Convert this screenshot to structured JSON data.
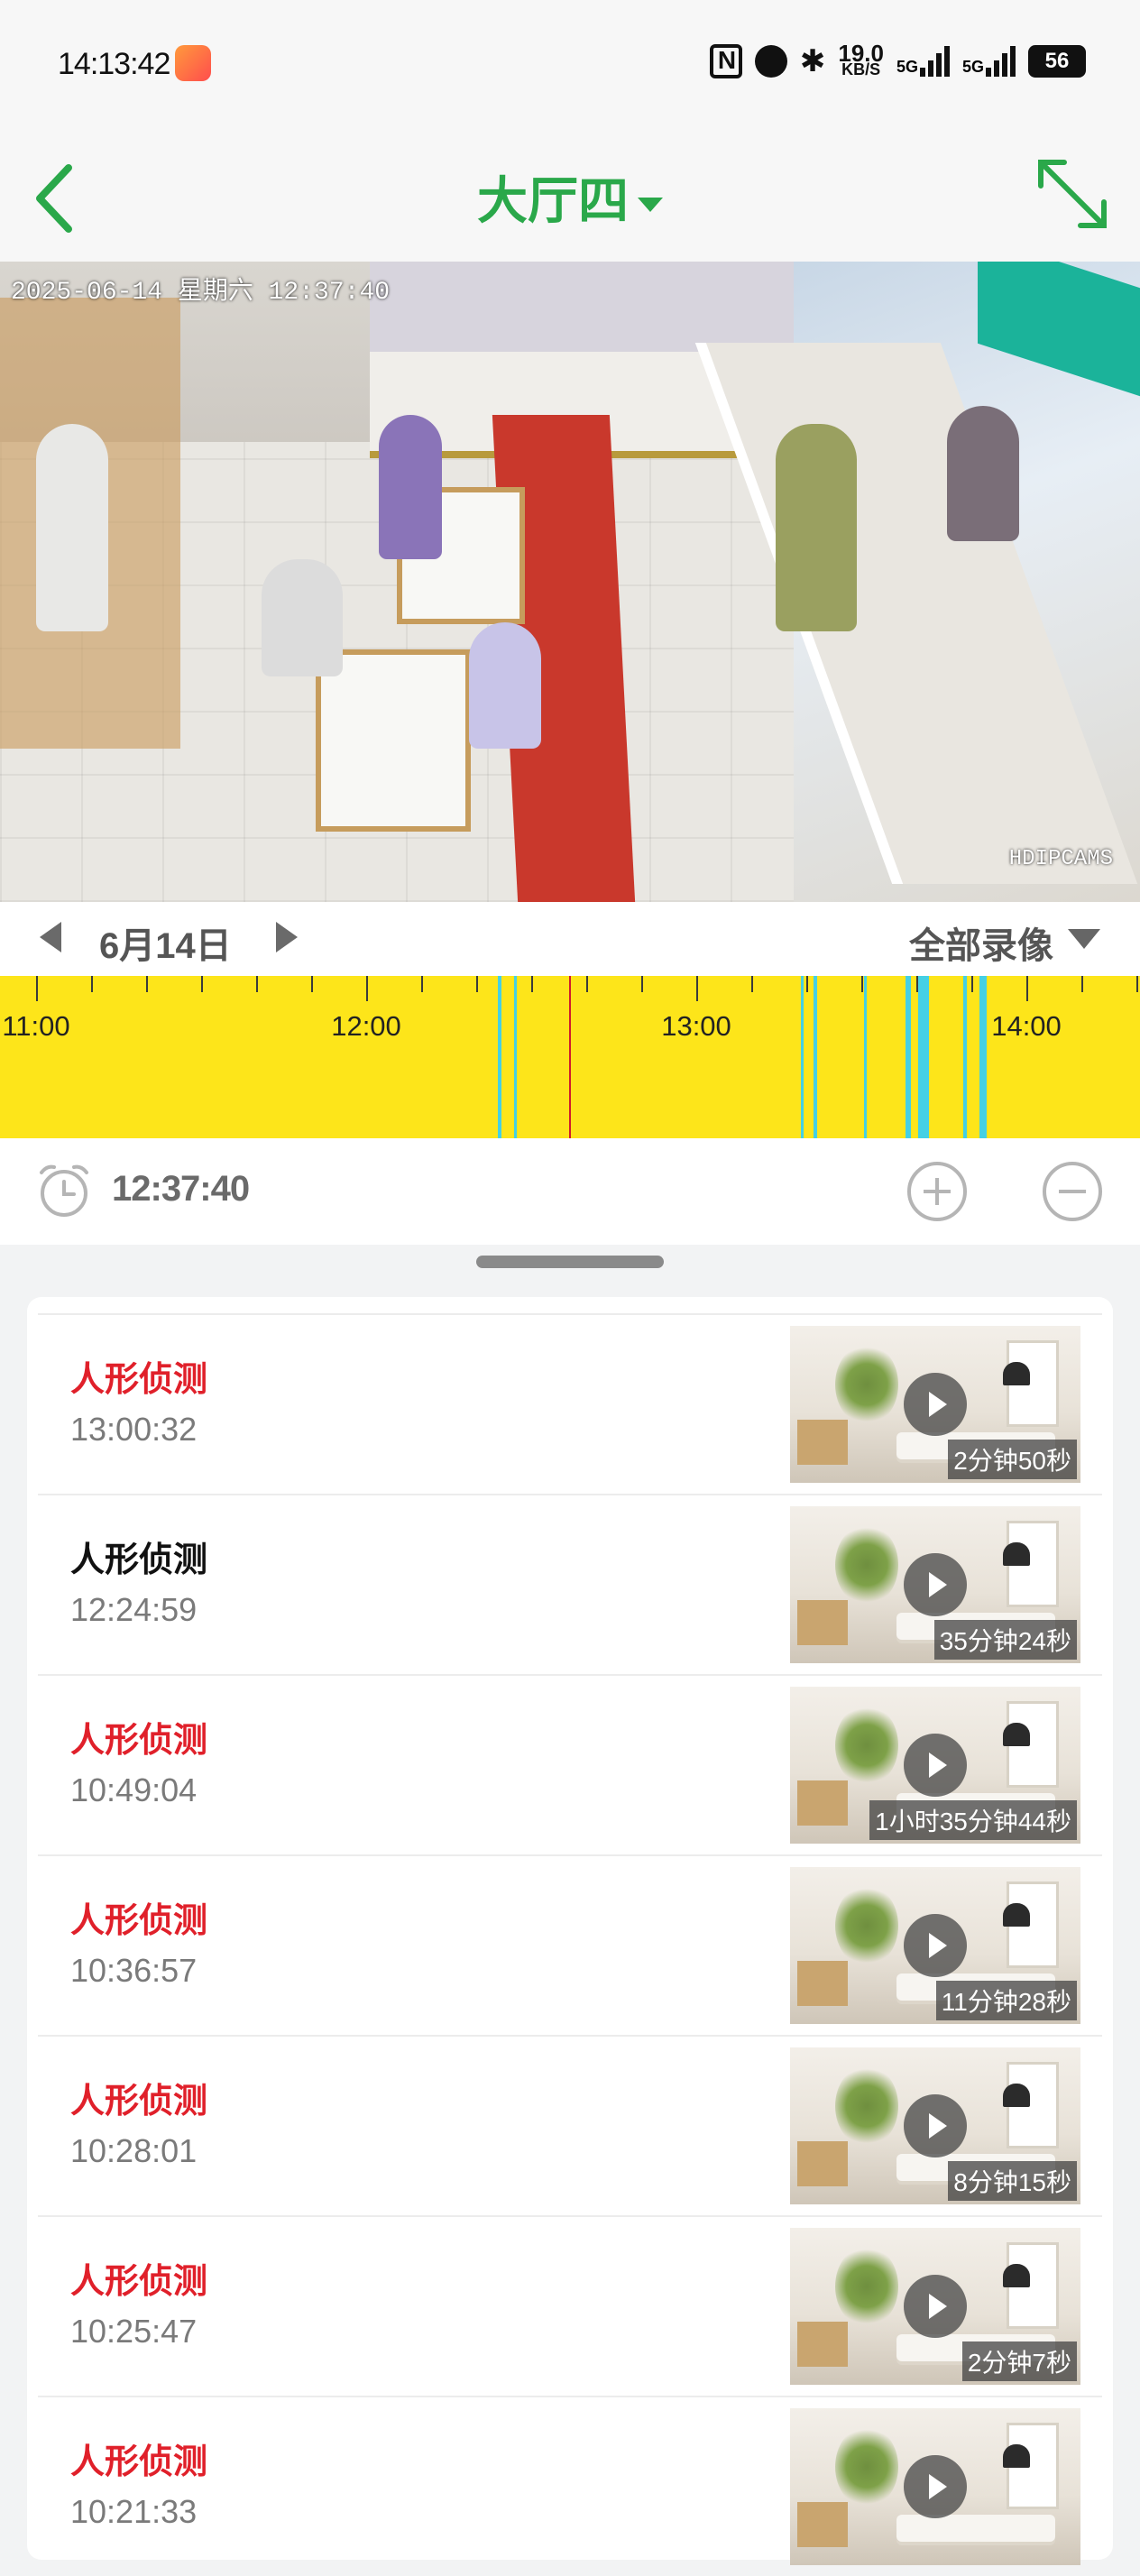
{
  "status_bar": {
    "time": "14:13:42",
    "net_speed_value": "19.0",
    "net_speed_unit": "KB/S",
    "sim1": "5G",
    "sim2": "5G",
    "battery": "56"
  },
  "header": {
    "title": "大厅四"
  },
  "video": {
    "osd_datetime": "2025-06-14 星期六 12:37:40",
    "osd_brand": "HDIPCAMS"
  },
  "date_nav": {
    "date": "6月14日",
    "filter": "全部录像"
  },
  "timeline": {
    "labels": [
      "11:00",
      "12:00",
      "13:00",
      "14:00"
    ],
    "background_color": "#fde51a",
    "segment_color": "#45d0e4",
    "cursor_color": "#d11b2c"
  },
  "playback": {
    "current_time": "12:37:40"
  },
  "events": [
    {
      "title": "人形侦测",
      "time": "13:00:32",
      "duration": "2分钟50秒",
      "highlight": true
    },
    {
      "title": "人形侦测",
      "time": "12:24:59",
      "duration": "35分钟24秒",
      "highlight": false
    },
    {
      "title": "人形侦测",
      "time": "10:49:04",
      "duration": "1小时35分钟44秒",
      "highlight": true
    },
    {
      "title": "人形侦测",
      "time": "10:36:57",
      "duration": "11分钟28秒",
      "highlight": true
    },
    {
      "title": "人形侦测",
      "time": "10:28:01",
      "duration": "8分钟15秒",
      "highlight": true
    },
    {
      "title": "人形侦测",
      "time": "10:25:47",
      "duration": "2分钟7秒",
      "highlight": true
    },
    {
      "title": "人形侦测",
      "time": "10:21:33",
      "duration": "",
      "highlight": true
    }
  ]
}
